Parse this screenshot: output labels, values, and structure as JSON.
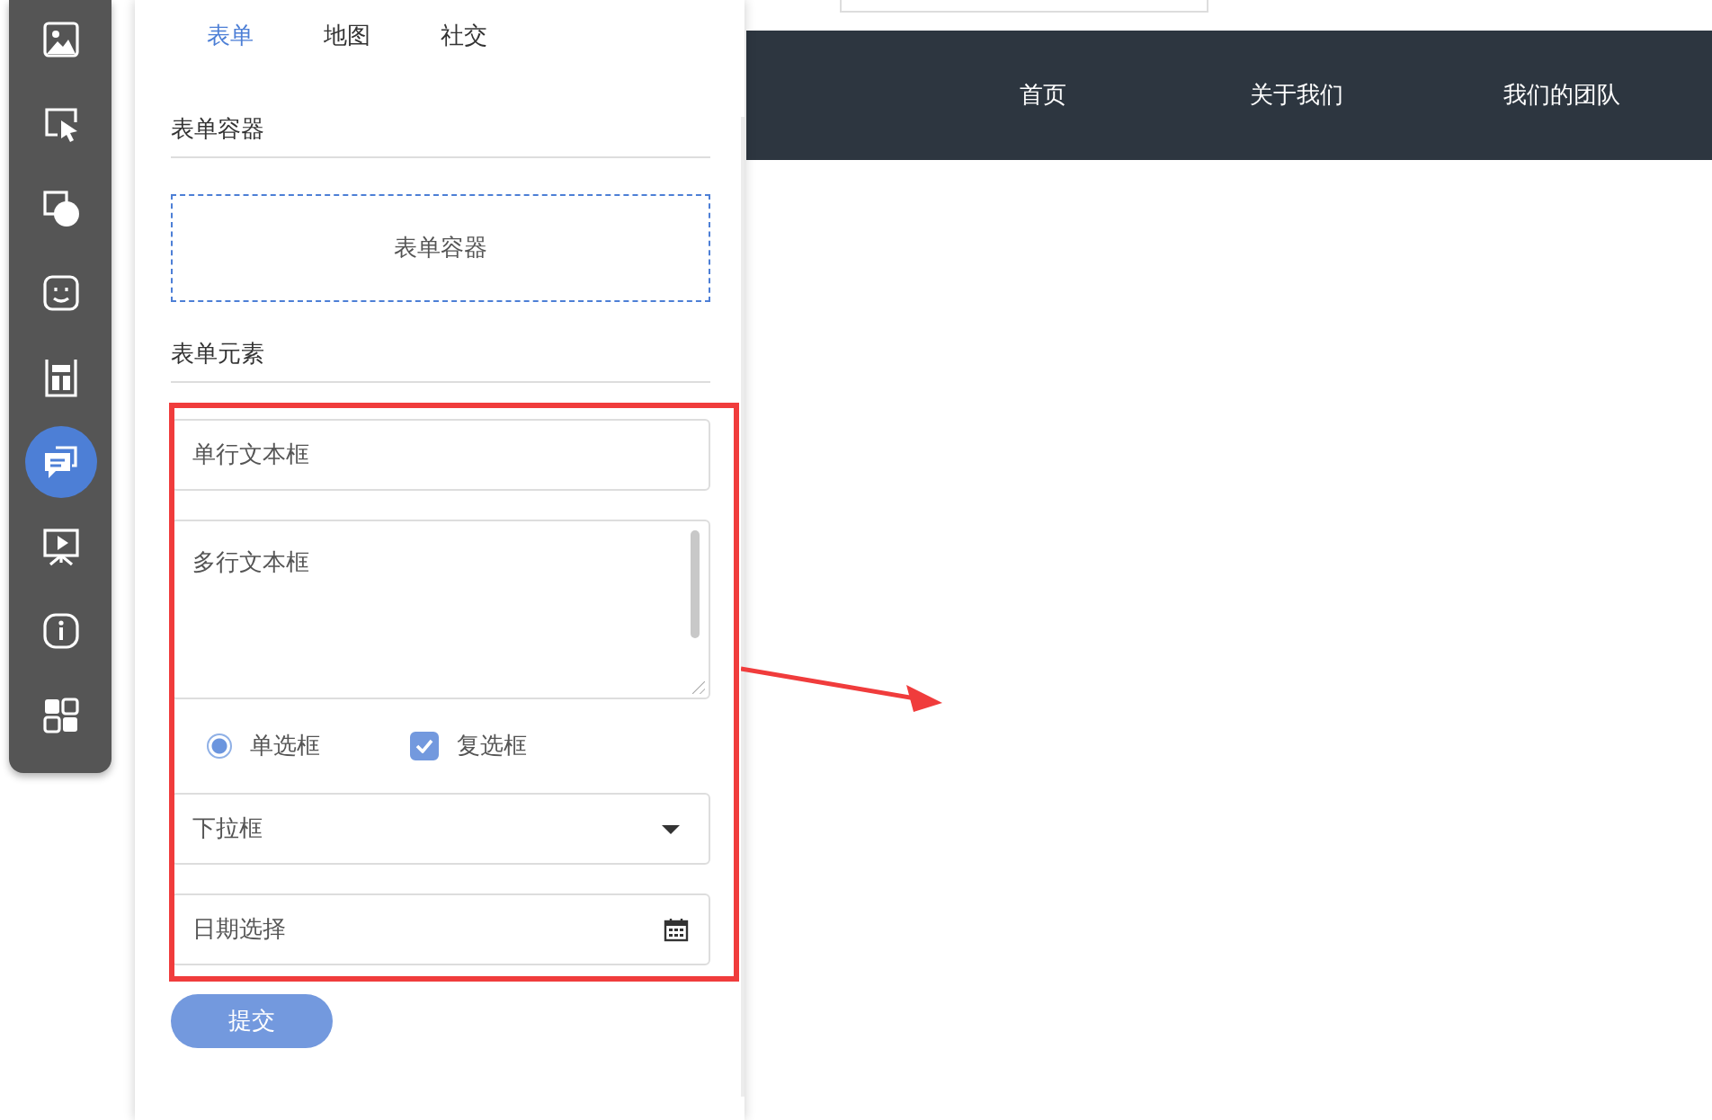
{
  "toolbar": {
    "tools": [
      {
        "kind": "image",
        "selected": false
      },
      {
        "kind": "cursor",
        "selected": false
      },
      {
        "kind": "shapes",
        "selected": false
      },
      {
        "kind": "face",
        "selected": false
      },
      {
        "kind": "layout",
        "selected": false
      },
      {
        "kind": "chat",
        "selected": true
      },
      {
        "kind": "slideshow",
        "selected": false
      },
      {
        "kind": "info",
        "selected": false
      },
      {
        "kind": "grid",
        "selected": false
      }
    ]
  },
  "panel": {
    "tabs": [
      {
        "label": "表单",
        "selected": true
      },
      {
        "label": "地图",
        "selected": false
      },
      {
        "label": "社交",
        "selected": false
      }
    ],
    "container_section": {
      "heading": "表单容器",
      "item": "表单容器"
    },
    "elements_section": {
      "heading": "表单元素",
      "items": [
        {
          "kind": "text",
          "placeholder": "单行文本框"
        },
        {
          "kind": "textarea",
          "placeholder": "多行文本框"
        },
        {
          "kind": "choices",
          "radio": {
            "label": "单选框",
            "selected": true
          },
          "checkbox": {
            "label": "复选框",
            "checked": true
          }
        },
        {
          "kind": "select",
          "placeholder": "下拉框"
        },
        {
          "kind": "date",
          "placeholder": "日期选择"
        }
      ]
    },
    "submit": "提交"
  },
  "canvas": {
    "nav": [
      "首页",
      "关于我们",
      "我们的团队"
    ]
  }
}
